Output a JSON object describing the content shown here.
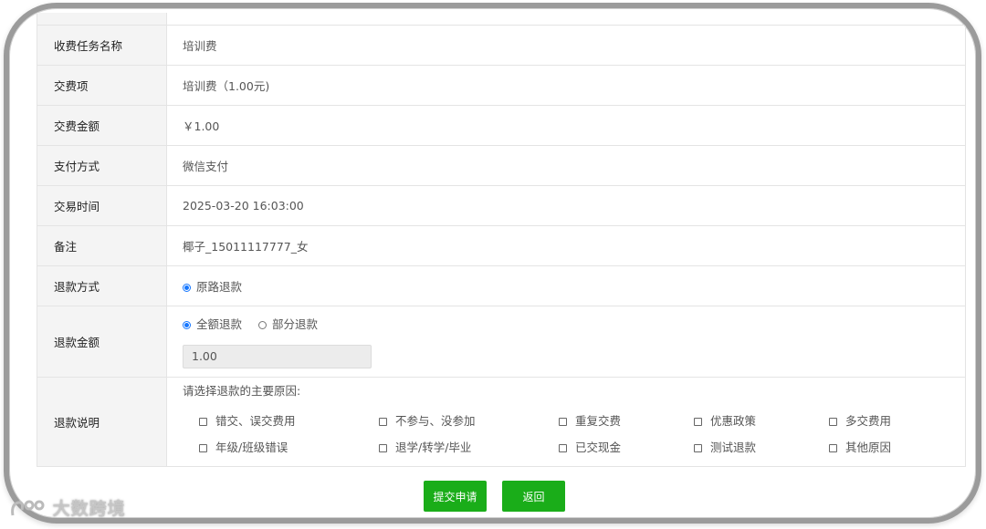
{
  "form": {
    "rows": [
      {
        "label": "收费任务名称",
        "value": "培训费"
      },
      {
        "label": "交费项",
        "value": "培训费（1.00元)"
      },
      {
        "label": "交费金额",
        "value": "￥1.00"
      },
      {
        "label": "支付方式",
        "value": "微信支付"
      },
      {
        "label": "交易时间",
        "value": "2025-03-20 16:03:00"
      },
      {
        "label": "备注",
        "value": "椰子_15011117777_女"
      }
    ],
    "refund_method": {
      "label": "退款方式",
      "options": [
        {
          "label": "原路退款",
          "selected": true
        }
      ]
    },
    "refund_amount": {
      "label": "退款金额",
      "options": [
        {
          "label": "全额退款",
          "selected": true
        },
        {
          "label": "部分退款",
          "selected": false
        }
      ],
      "value": "1.00"
    },
    "refund_desc": {
      "label": "退款说明",
      "prompt": "请选择退款的主要原因:",
      "reasons": [
        "错交、误交费用",
        "不参与、没参加",
        "重复交费",
        "优惠政策",
        "多交费用",
        "年级/班级错误",
        "退学/转学/毕业",
        "已交现金",
        "测试退款",
        "其他原因"
      ]
    }
  },
  "buttons": {
    "submit": "提交申请",
    "back": "返回"
  },
  "watermark": "大数跨境",
  "colors": {
    "accent_green": "#1aad19",
    "radio_blue": "#1677ff"
  }
}
